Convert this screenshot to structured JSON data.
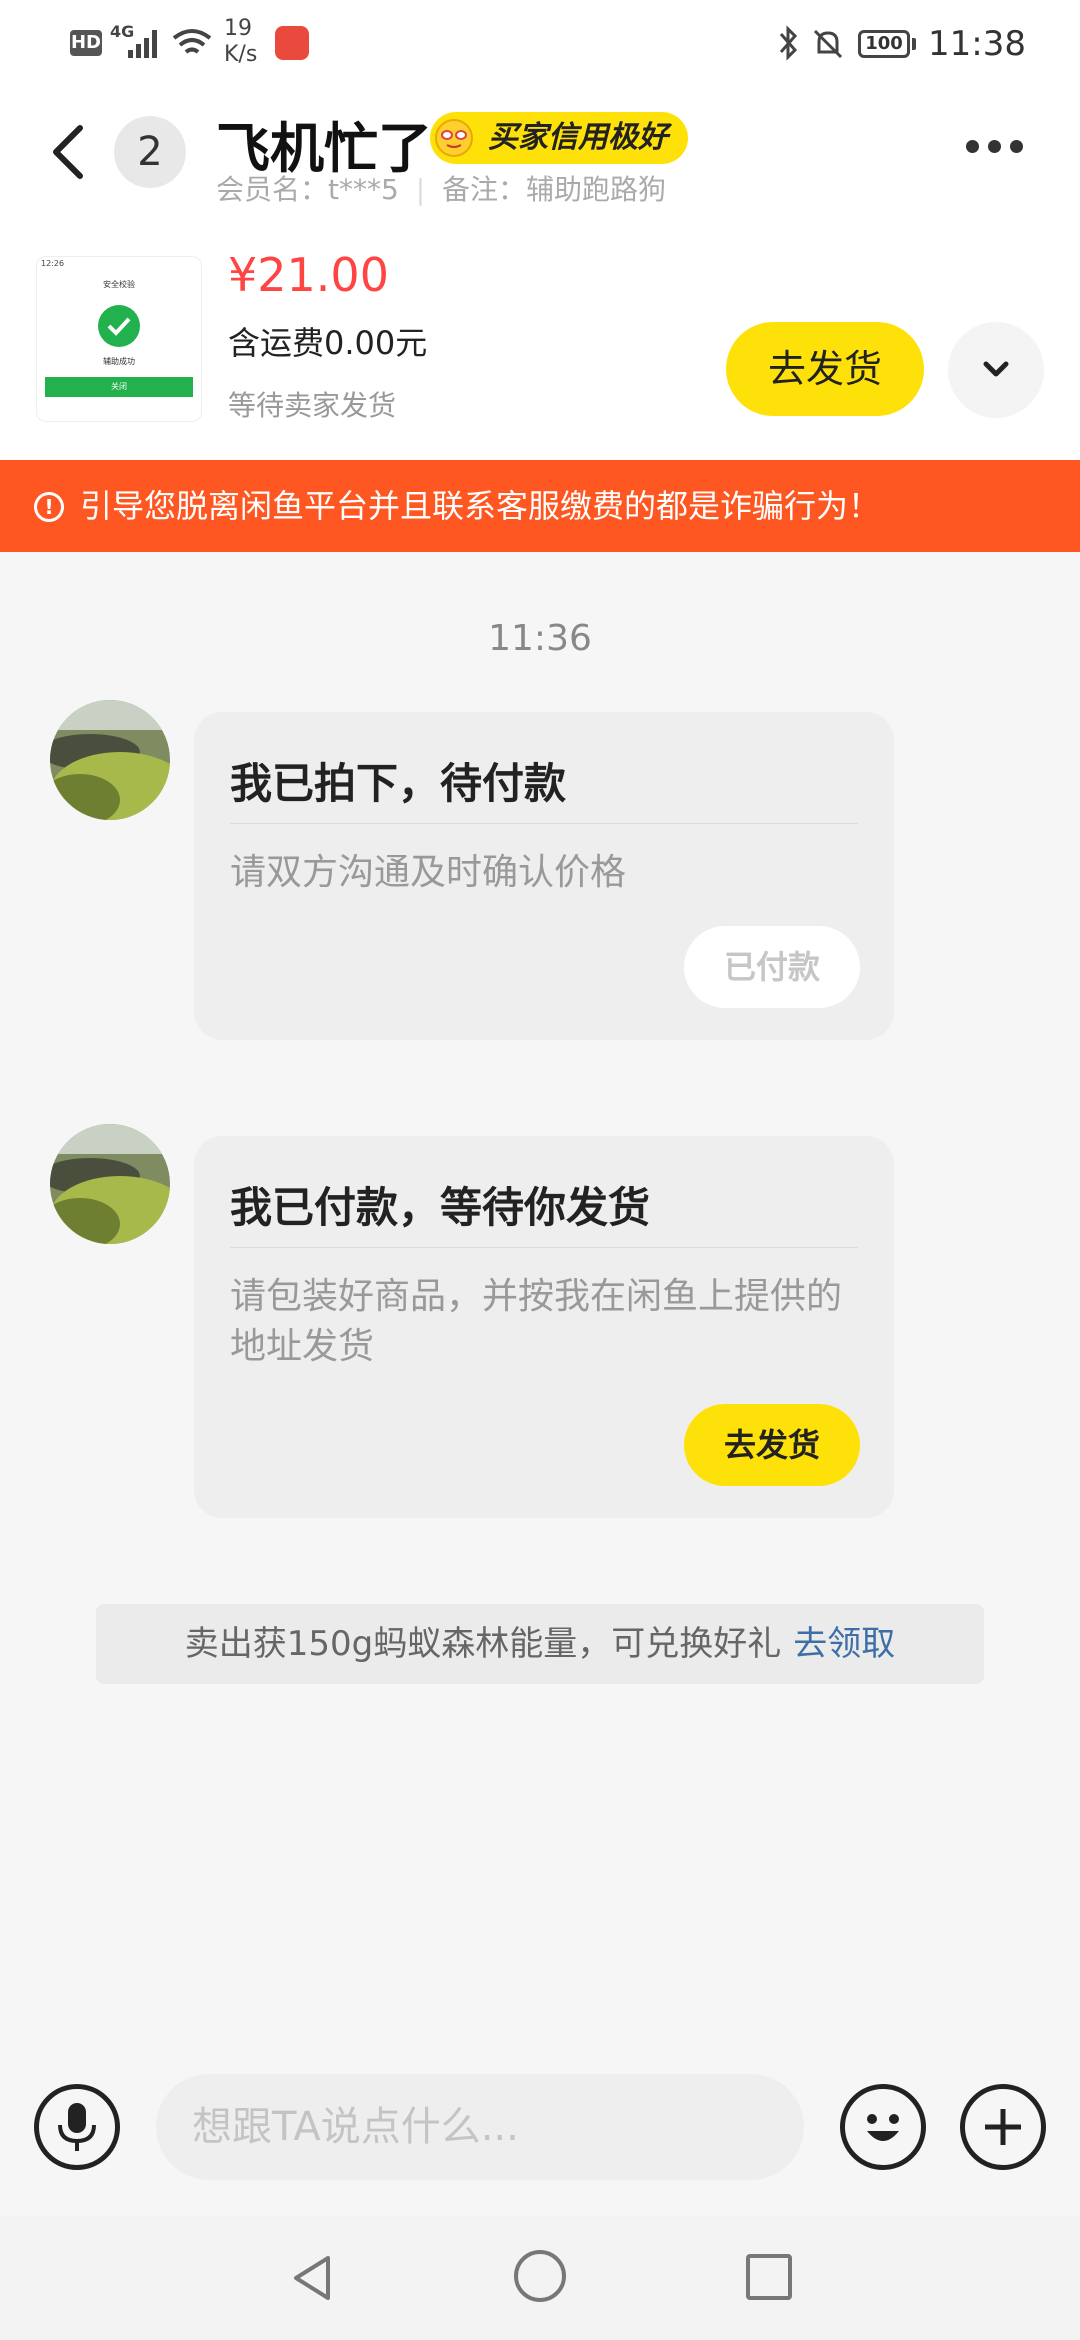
{
  "status_bar": {
    "hd": "HD",
    "network": "4G",
    "speed_value": "19",
    "speed_unit": "K/s",
    "battery": "100",
    "time": "11:38"
  },
  "header": {
    "unread_count": "2",
    "title": "飞机忙了",
    "credit_badge": "买家信用极好",
    "member_label": "会员名：t***5",
    "note_label": "备注：辅助跑路狗"
  },
  "order": {
    "thumb_time": "12:26",
    "thumb_title": "安全校验",
    "thumb_success": "辅助成功",
    "thumb_button": "关闭",
    "price": "¥21.00",
    "shipping": "含运费0.00元",
    "status": "等待卖家发货",
    "ship_button": "去发货"
  },
  "warning": {
    "text": "引导您脱离闲鱼平台并且联系客服缴费的都是诈骗行为！"
  },
  "chat": {
    "timestamp": "11:36",
    "messages": [
      {
        "title": "我已拍下，待付款",
        "body": "请双方沟通及时确认价格",
        "button": "已付款"
      },
      {
        "title": "我已付款，等待你发货",
        "body": "请包装好商品，并按我在闲鱼上提供的地址发货",
        "button": "去发货"
      }
    ],
    "promo_text": "卖出获150g蚂蚁森林能量，可兑换好礼",
    "promo_link": "去领取"
  },
  "input": {
    "placeholder": "想跟TA说点什么..."
  },
  "colors": {
    "accent_yellow": "#ffe10a",
    "warning_orange": "#ff5722",
    "price_red": "#ff4444",
    "link_blue": "#3d6fa6"
  },
  "icons": [
    "back-arrow-icon",
    "more-icon",
    "chevron-down-icon",
    "alert-icon",
    "mic-icon",
    "emoji-icon",
    "plus-icon"
  ]
}
